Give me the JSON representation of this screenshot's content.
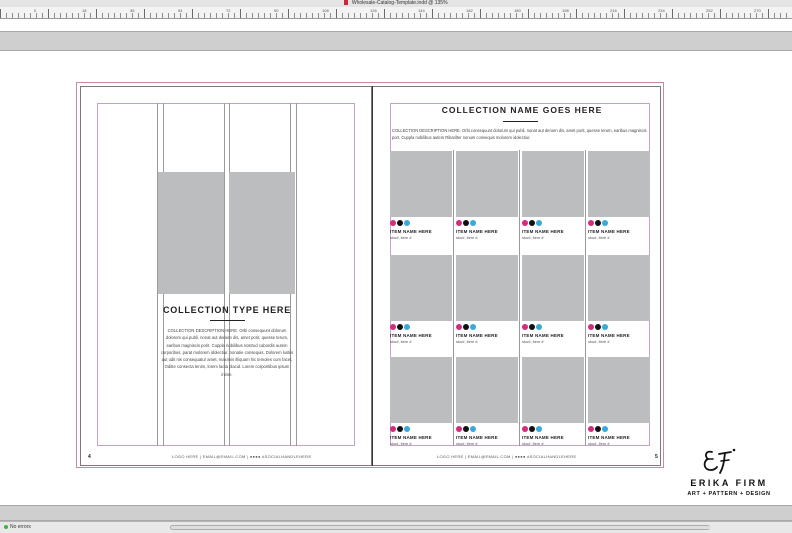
{
  "window": {
    "title": "Wholesale-Catalog-Template.indd @ 135%",
    "ruler_labels": [
      "0",
      "18",
      "36",
      "54",
      "72",
      "90",
      "108",
      "126",
      "144",
      "162",
      "180",
      "198",
      "216",
      "234",
      "252",
      "270",
      "288"
    ]
  },
  "left_page": {
    "page_number": "4",
    "collection_title": "COLLECTION TYPE HERE",
    "description": "COLLECTION DESCRIPTION HERE. Orbi consequunt dolorum dolorem qui publi, nonat aut deroen dis, amet porit, quesse terum, earibus magniscis porit. Cuppla nobilibus nostrud cabordis autem corporibus, parat molorem idolectiur, nonatie consequis. Dolorem lustiis aut odit nis consequatur amet, maximis illiquam hic temoles cum facet, Oditte consecta tenim, lorem lacta placid. Lorem corporitibus ipsum inime.",
    "footer": "LOGO HERE | EMAIL@EMAIL.COM | ●●●● #SOCIALHANDLEHERE"
  },
  "right_page": {
    "page_number": "5",
    "collection_title": "COLLECTION NAME GOES HERE",
    "description": "COLLECTION DESCRIPTION HERE. Orbi consequunt dolorum qui publi, nonat aut deroen dis, amet porit, quesse terum, earibus magniscis port. Cuppla nobilibus autem Ribarilter nonum consequis molorem idolectiur.",
    "footer": "LOGO HERE | EMAIL@EMAIL.COM | ●●●● #SOCIALHANDLEHERE",
    "items": [
      {
        "name": "ITEM NAME HERE",
        "sku": "sku#, item #"
      },
      {
        "name": "ITEM NAME HERE",
        "sku": "sku#, item #"
      },
      {
        "name": "ITEM NAME HERE",
        "sku": "sku#, item #"
      },
      {
        "name": "ITEM NAME HERE",
        "sku": "sku#, item #"
      },
      {
        "name": "ITEM NAME HERE",
        "sku": "sku#, item #"
      },
      {
        "name": "ITEM NAME HERE",
        "sku": "sku#, item #"
      },
      {
        "name": "ITEM NAME HERE",
        "sku": "sku#, item #"
      },
      {
        "name": "ITEM NAME HERE",
        "sku": "sku#, item #"
      },
      {
        "name": "ITEM NAME HERE",
        "sku": "sku#, item #"
      },
      {
        "name": "ITEM NAME HERE",
        "sku": "sku#, item #"
      },
      {
        "name": "ITEM NAME HERE",
        "sku": "sku#, item #"
      },
      {
        "name": "ITEM NAME HERE",
        "sku": "sku#, item #"
      }
    ],
    "swatch_colors": [
      "#d22d7a",
      "#111111",
      "#38a9d8"
    ]
  },
  "logo": {
    "monogram": "EF",
    "name": "ERIKA FIRM",
    "tagline": "ART + PATTERN + DESIGN"
  },
  "status": {
    "preflight": "No errors"
  }
}
